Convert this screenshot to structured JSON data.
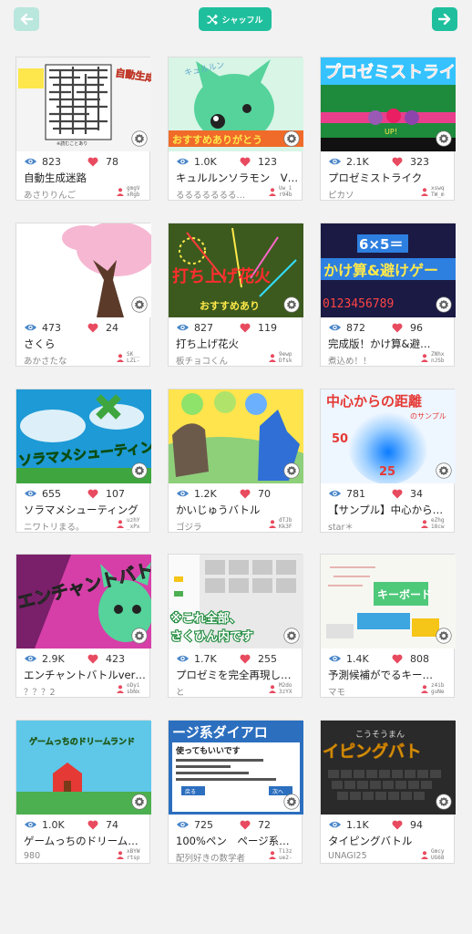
{
  "header": {
    "shuffle_label": "シャッフル"
  },
  "colors": {
    "accent": "#1fbf9d",
    "accent_light": "#b9e6dd",
    "heart": "#e84a5f",
    "eye": "#4a86c8"
  },
  "cards": [
    {
      "title": "自動生成迷路",
      "author": "あさりりんご",
      "views": "823",
      "likes": "78",
      "uid_line1": "gmgV",
      "uid_line2": "xRgb",
      "thumb_text": "自動生成迷路",
      "thumb_sub": "※読むことあり"
    },
    {
      "title": "キュルルンソラモン　V…",
      "author": "るるるるるるる…",
      "views": "1.0K",
      "likes": "123",
      "uid_line1": "Uw_i",
      "uid_line2": "r94b",
      "thumb_text": "おすすめありがとう",
      "thumb_sub": "キュルルン"
    },
    {
      "title": "プロゼミストライク",
      "author": "ピカソ",
      "views": "2.1K",
      "likes": "323",
      "uid_line1": "xswq",
      "uid_line2": "TW_m",
      "thumb_text": "プロゼミストライク",
      "thumb_sub": "UP！"
    },
    {
      "title": "さくら",
      "author": "あかさたな",
      "views": "473",
      "likes": "24",
      "uid_line1": "SK__",
      "uid_line2": "LZL-"
    },
    {
      "title": "打ち上げ花火",
      "author": "板チョコくん",
      "views": "827",
      "likes": "119",
      "uid_line1": "9ewp",
      "uid_line2": "Dfsk",
      "thumb_text": "打ち上げ花火",
      "thumb_sub": "おすすめあり"
    },
    {
      "title": "完成版！かけ算&避…",
      "author": "煮込め！！",
      "views": "872",
      "likes": "96",
      "uid_line1": "ZNhx",
      "uid_line2": "nJSb",
      "thumb_text": "かけ算&避けゲー",
      "thumb_sub": "6×5＝",
      "thumb_digits": "0123456789"
    },
    {
      "title": "ソラマメシューティング",
      "author": "ニワトリまる。",
      "views": "655",
      "likes": "107",
      "uid_line1": "uzhY",
      "uid_line2": "_xPx",
      "thumb_text": "ソラマメシューティング"
    },
    {
      "title": "かいじゅうバトル",
      "author": "ゴジラ",
      "views": "1.2K",
      "likes": "70",
      "uid_line1": "dTJb",
      "uid_line2": "Kk3F"
    },
    {
      "title": "【サンプル】中心から…",
      "author": "star＊",
      "views": "781",
      "likes": "34",
      "uid_line1": "eZhg",
      "uid_line2": "18cw",
      "thumb_text": "中心からの距離",
      "thumb_sub": "のサンプル",
      "thumb_n1": "50",
      "thumb_n2": "25"
    },
    {
      "title": "エンチャントバトルver…",
      "author": "？？？2",
      "views": "2.9K",
      "likes": "423",
      "uid_line1": "oDyi",
      "uid_line2": "sbNx",
      "thumb_text": "エンチャントバトル"
    },
    {
      "title": "プロゼミを完全再現し…",
      "author": "と",
      "views": "1.7K",
      "likes": "255",
      "uid_line1": "M2do",
      "uid_line2": "3zYX",
      "thumb_text": "※これ全部、",
      "thumb_sub": "さくひん内です"
    },
    {
      "title": "予測候補がでるキー…",
      "author": "マモ",
      "views": "1.4K",
      "likes": "808",
      "uid_line1": "z4ib",
      "uid_line2": "guNe",
      "thumb_text": "キーボード"
    },
    {
      "title": "ゲームっちのドリーム…",
      "author": "980",
      "views": "1.0K",
      "likes": "74",
      "uid_line1": "xBYW",
      "uid_line2": "rtsp",
      "thumb_text": "ゲームっちのドリームランド"
    },
    {
      "title": "100%ペン　ページ系…",
      "author": "配列好きの数学者",
      "views": "725",
      "likes": "72",
      "uid_line1": "Ti3z",
      "uid_line2": "ue2-",
      "thumb_text": "ージ系ダイアロ",
      "thumb_sub": "使ってもいいです",
      "thumb_b1": "戻る",
      "thumb_b2": "次へ"
    },
    {
      "title": "タイピングバトル",
      "author": "UNAGI25",
      "views": "1.1K",
      "likes": "94",
      "uid_line1": "Gmcy",
      "uid_line2": "UG68",
      "thumb_text": "イピングバト",
      "thumb_sub": "こうそうまん"
    }
  ]
}
